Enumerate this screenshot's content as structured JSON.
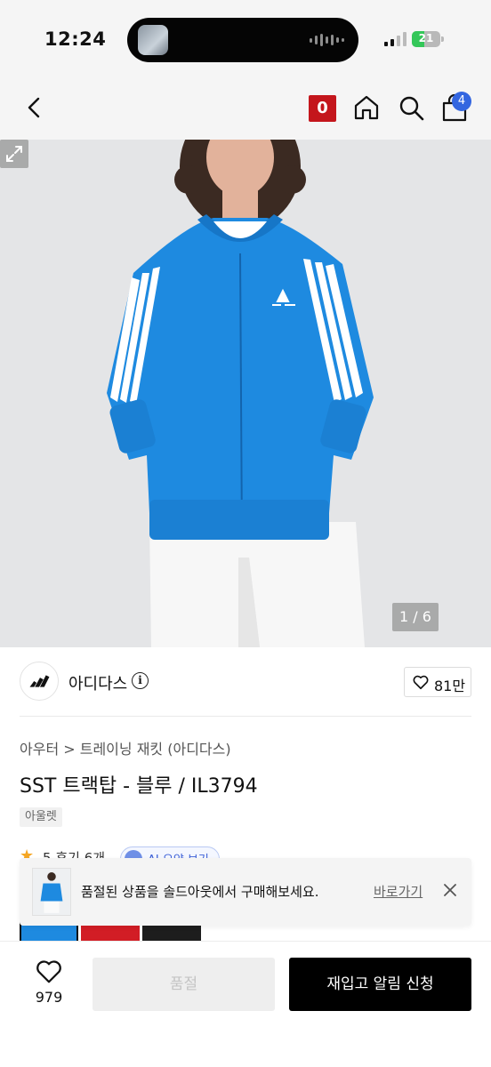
{
  "status_bar": {
    "time": "12:24",
    "battery": "21"
  },
  "header": {
    "cart_badge": "0",
    "bag_count": "4"
  },
  "gallery": {
    "counter": "1 / 6"
  },
  "brand": {
    "name": "아디다스",
    "likes": "81만"
  },
  "product": {
    "breadcrumb": "아우터 > 트레이닝 재킷 (아디다스)",
    "title": "SST 트랙탑 - 블루 / IL3794",
    "tag": "아울렛",
    "rating": "5",
    "review_text": "후기 6개",
    "pill_text": "AI 요약 보기"
  },
  "toast": {
    "message": "품절된 상품을 솔드아웃에서 구매해보세요.",
    "link": "바로가기"
  },
  "bottom": {
    "wish_count": "979",
    "soldout_label": "품절",
    "restock_label": "재입고 알림 신청"
  },
  "colors": {
    "brand_red": "#c4161c",
    "badge_blue": "#3366e0",
    "jacket_blue": "#1e8ae0"
  }
}
